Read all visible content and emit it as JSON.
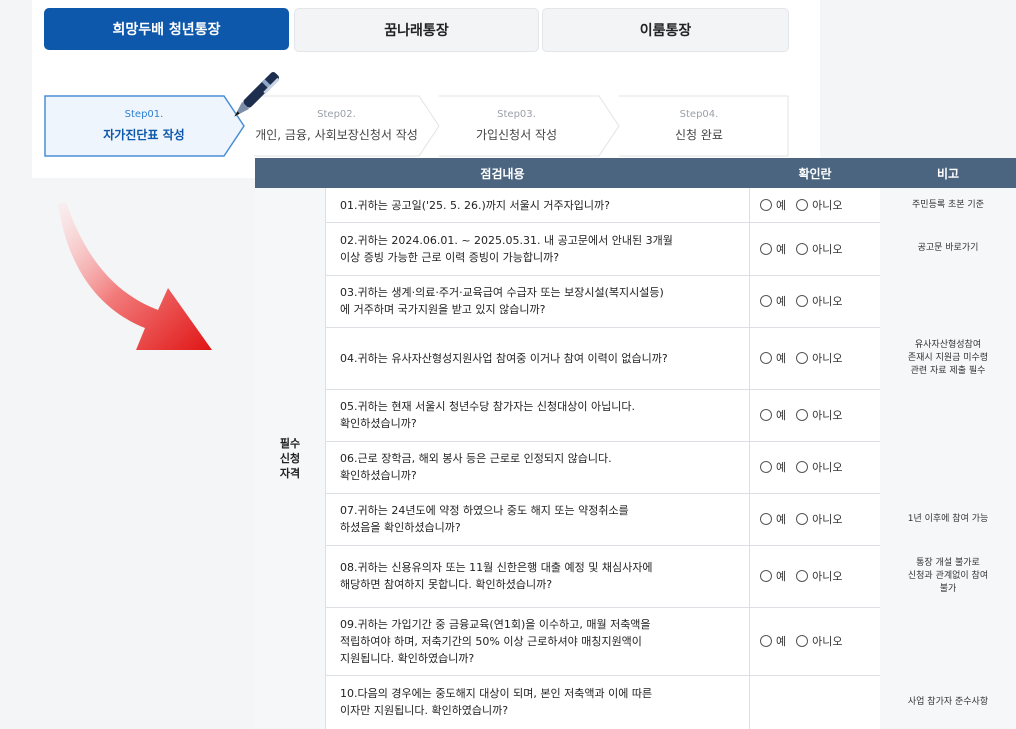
{
  "tabs": [
    {
      "label": "희망두배 청년통장",
      "active": true
    },
    {
      "label": "꿈나래통장",
      "active": false
    },
    {
      "label": "이룸통장",
      "active": false
    }
  ],
  "steps": [
    {
      "num": "Step01.",
      "label": "자가진단표 작성",
      "active": true
    },
    {
      "num": "Step02.",
      "label": "개인, 금융, 사회보장신청서 작성",
      "active": false
    },
    {
      "num": "Step03.",
      "label": "가입신청서 작성",
      "active": false
    },
    {
      "num": "Step04.",
      "label": "신청 완료",
      "active": false
    }
  ],
  "table": {
    "headers": {
      "content": "점검내용",
      "confirm": "확인란",
      "note": "비고"
    },
    "category": "필수\n신청\n자격",
    "option_yes": "예",
    "option_no": "아니오",
    "rows": [
      {
        "q": "01.귀하는 공고일('25. 5. 26.)까지 서울시 거주자입니까?",
        "note": "주민등록 초본 기준",
        "options": true
      },
      {
        "q": "02.귀하는 2024.06.01. ~ 2025.05.31. 내 공고문에서 안내된 3개월\n     이상 증빙 가능한 근로 이력 증빙이 가능합니까?",
        "note": "공고문 바로가기",
        "options": true
      },
      {
        "q": "03.귀하는 생계·의료·주거·교육급여 수급자 또는 보장시설(복지시설등)\n     에 거주하며 국가지원을 받고 있지 않습니까?",
        "note": "",
        "options": true
      },
      {
        "q": "04.귀하는 유사자산형성지원사업 참여중 이거나 참여 이력이 없습니까?",
        "note": "유사자산형성참여\n존재시 지원금 미수령\n관련 자료 제출 필수",
        "options": true
      },
      {
        "q": "05.귀하는 현재 서울시 청년수당 참가자는 신청대상이 아닙니다.\n     확인하셨습니까?",
        "note": "",
        "options": true
      },
      {
        "q": "06.근로 장학금, 해외 봉사 등은 근로로 인정되지 않습니다.\n     확인하셨습니까?",
        "note": "",
        "options": true
      },
      {
        "q": "07.귀하는 24년도에 약정 하였으나 중도 해지 또는 약정취소를\n     하셨음을 확인하셨습니까?",
        "note": "1년 이후에 참여 가능",
        "options": true
      },
      {
        "q": "08.귀하는 신용유의자 또는 11월 신한은행 대출 예정 및 채심사자에\n     해당하면 참여하지 못합니다. 확인하셨습니까?",
        "note": "통장 개설 불가로\n신청과 관계없이 참여\n불가",
        "options": true
      },
      {
        "q": "09.귀하는 가입기간 중 금융교육(연1회)을 이수하고, 매월 저축액을\n     적립하여야 하며, 저축기간의 50% 이상 근로하셔야 매칭지원액이\n     지원됩니다. 확인하였습니까?",
        "note": "",
        "options": true
      },
      {
        "q": "10.다음의 경우에는 중도해지 대상이 되며, 본인 저축액과 이에 따른\n     이자만 지원됩니다. 확인하였습니까?",
        "note": "사업 참가자 준수사항",
        "options": false
      }
    ]
  },
  "colors": {
    "accent": "#0d58aa",
    "header_bg": "#4b6581",
    "arrow": "#e32b2b"
  },
  "icons": [
    "pen-icon",
    "curved-arrow-icon",
    "radio-icon"
  ]
}
